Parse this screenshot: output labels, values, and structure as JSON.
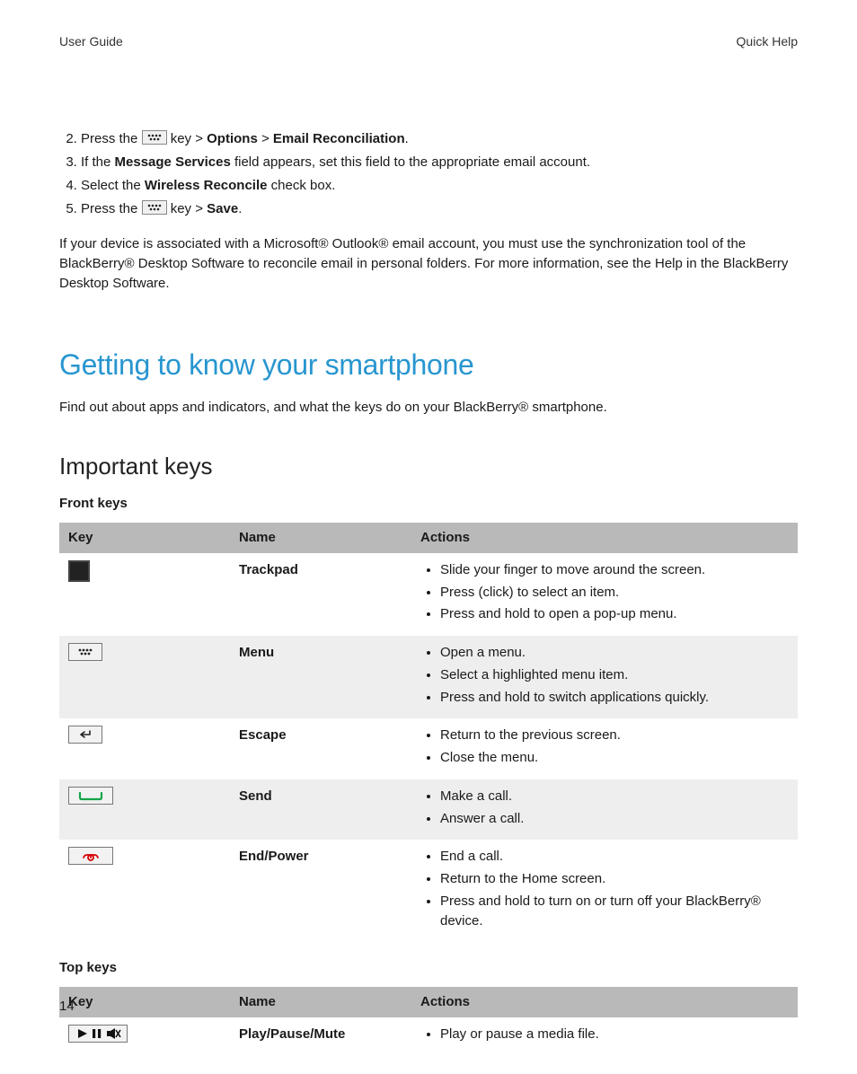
{
  "header": {
    "left": "User Guide",
    "right": "Quick Help"
  },
  "steps": {
    "s2": {
      "num": "2.",
      "a": "Press the ",
      "b": " key > ",
      "c": "Options",
      "d": " > ",
      "e": "Email Reconciliation",
      "f": "."
    },
    "s3": {
      "num": "3.",
      "a": "If the ",
      "b": "Message Services",
      "c": " field appears, set this field to the appropriate email account."
    },
    "s4": {
      "num": "4.",
      "a": "Select the ",
      "b": "Wireless Reconcile",
      "c": " check box."
    },
    "s5": {
      "num": "5.",
      "a": "Press the ",
      "b": " key > ",
      "c": "Save",
      "d": "."
    }
  },
  "outlook_note": "If your device is associated with a Microsoft® Outlook® email account, you must use the synchronization tool of the BlackBerry® Desktop Software to reconcile email in personal folders. For more information, see the Help in the BlackBerry Desktop Software.",
  "h1": "Getting to know your smartphone",
  "intro": "Find out about apps and indicators, and what the keys do on your BlackBerry® smartphone.",
  "h2": "Important keys",
  "front_caption": "Front keys",
  "top_caption": "Top keys",
  "cols": {
    "key": "Key",
    "name": "Name",
    "actions": "Actions"
  },
  "rows_front": [
    {
      "name": "Trackpad",
      "actions": [
        "Slide your finger to move around the screen.",
        "Press (click) to select an item.",
        "Press and hold to open a pop-up menu."
      ]
    },
    {
      "name": "Menu",
      "actions": [
        "Open a menu.",
        "Select a highlighted menu item.",
        "Press and hold to switch applications quickly."
      ]
    },
    {
      "name": "Escape",
      "actions": [
        "Return to the previous screen.",
        "Close the menu."
      ]
    },
    {
      "name": "Send",
      "actions": [
        "Make a call.",
        "Answer a call."
      ]
    },
    {
      "name": "End/Power",
      "actions": [
        "End a call.",
        "Return to the Home screen.",
        "Press and hold to turn on or turn off your BlackBerry® device."
      ]
    }
  ],
  "rows_top": [
    {
      "name": "Play/Pause/Mute",
      "actions": [
        "Play or pause a media file."
      ]
    }
  ],
  "page_number": "14"
}
